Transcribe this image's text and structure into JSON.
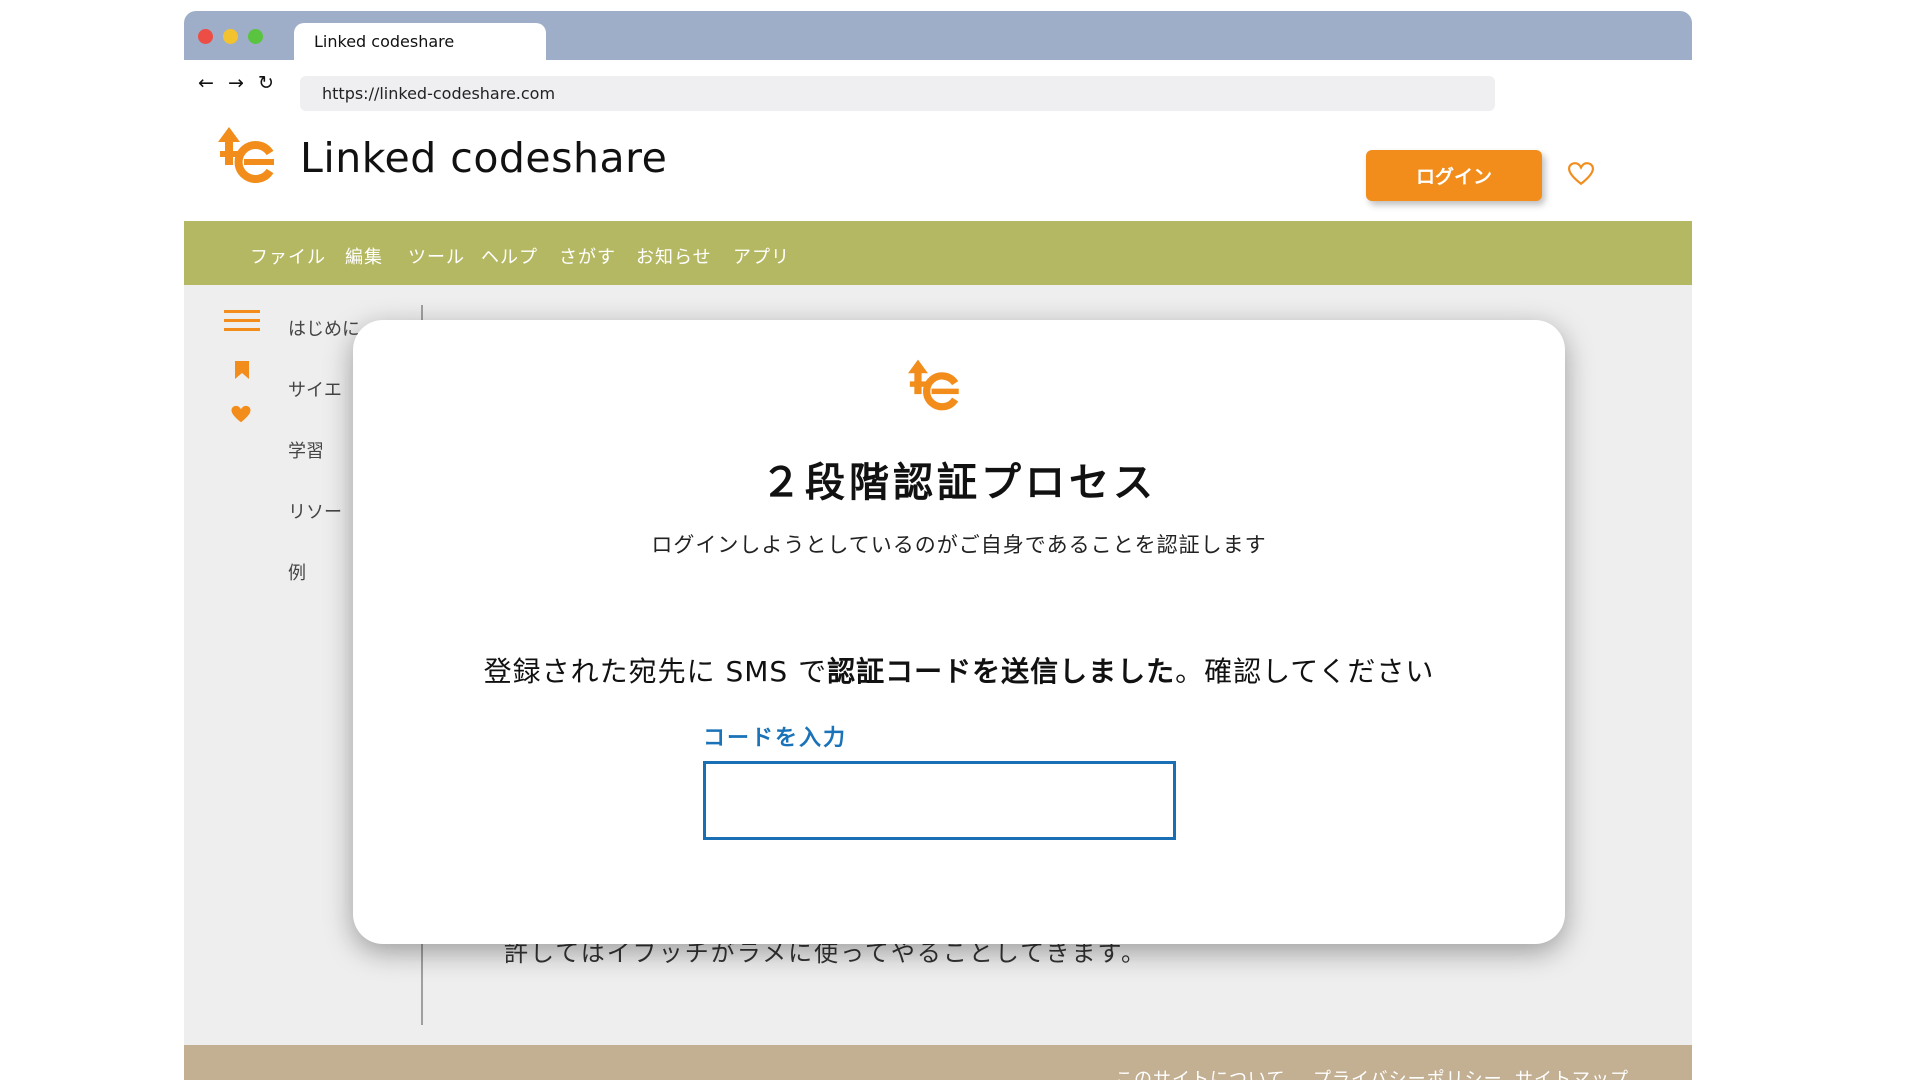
{
  "browser": {
    "tab_title": "Linked codeshare",
    "url": "https://linked-codeshare.com",
    "back_icon": "←",
    "forward_icon": "→",
    "reload_icon": "↻"
  },
  "header": {
    "site_name": "Linked codeshare",
    "login_label": "ログイン"
  },
  "menu": {
    "items": [
      "ファイル",
      "編集",
      "ツール",
      "ヘルプ",
      "さがす",
      "お知らせ",
      "アプリ"
    ]
  },
  "sidebar": {
    "items": [
      "はじめに",
      "サイエ",
      "学習",
      "リソー",
      "例"
    ]
  },
  "background_text": "許してはイブッチがラメに使ってやることしてきます。",
  "footer": {
    "links": [
      "このサイトについて",
      "プライバシーポリシー",
      "サイトマップ"
    ]
  },
  "modal": {
    "title": "２段階認証プロセス",
    "subtitle": "ログインしようとしているのがご自身であることを認証します",
    "message_prefix": "登録された宛先に SMS で",
    "message_bold": "認証コードを送信しました",
    "message_suffix": "。確認してください",
    "code_label": "コードを入力",
    "code_value": ""
  },
  "colors": {
    "titlebar": "#9eaec8",
    "accent_orange": "#f28d1c",
    "menubar": "#b5b863",
    "footer": "#c3af92",
    "link_blue": "#1a73b8"
  }
}
